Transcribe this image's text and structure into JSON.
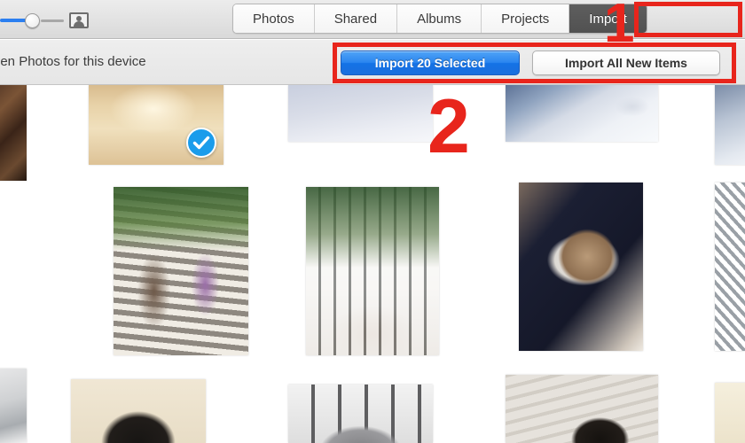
{
  "app": {
    "name": "Photos",
    "window_title": "Photos"
  },
  "toolbar": {
    "zoom_slider": {
      "name": "thumbnail-size-slider",
      "value_percent": 38
    },
    "portrait_icon": "portrait-icon",
    "tabs": [
      {
        "label": "Photos",
        "selected": false
      },
      {
        "label": "Shared",
        "selected": false
      },
      {
        "label": "Albums",
        "selected": false
      },
      {
        "label": "Projects",
        "selected": false
      },
      {
        "label": "Import",
        "selected": true
      }
    ]
  },
  "subbar": {
    "device_text": "pen Photos for this device",
    "import_selected_label": "Import 20 Selected",
    "import_all_label": "Import All New Items"
  },
  "annotations": [
    {
      "id": "1",
      "label": "1",
      "target": "import-tab"
    },
    {
      "id": "2",
      "label": "2",
      "target": "import-buttons"
    }
  ],
  "colors": {
    "annotation_red": "#e8251c",
    "primary_button_blue": "#1a7ae8",
    "selected_tab_gray": "#565656",
    "check_badge_blue": "#1a9ceb",
    "toolbar_gray": "#e6e6e6"
  },
  "grid": {
    "selected_count": 20,
    "photos": [
      {
        "alt": "dark doorway partial",
        "selected": false
      },
      {
        "alt": "sunny path with people",
        "selected": true
      },
      {
        "alt": "snowy white sky",
        "selected": false
      },
      {
        "alt": "snow drift landscape",
        "selected": false
      },
      {
        "alt": "blue sky partial",
        "selected": false
      },
      {
        "alt": "two people under tree",
        "selected": false
      },
      {
        "alt": "house porch with windows",
        "selected": false
      },
      {
        "alt": "baby sleeping on dark blanket",
        "selected": false
      },
      {
        "alt": "checkered fabric partial",
        "selected": false
      },
      {
        "alt": "gray wall partial",
        "selected": false
      },
      {
        "alt": "black cat close up",
        "selected": false
      },
      {
        "alt": "gray cat behind railing",
        "selected": false
      },
      {
        "alt": "black cat on carpet",
        "selected": false
      },
      {
        "alt": "cream wall partial",
        "selected": false
      }
    ]
  }
}
